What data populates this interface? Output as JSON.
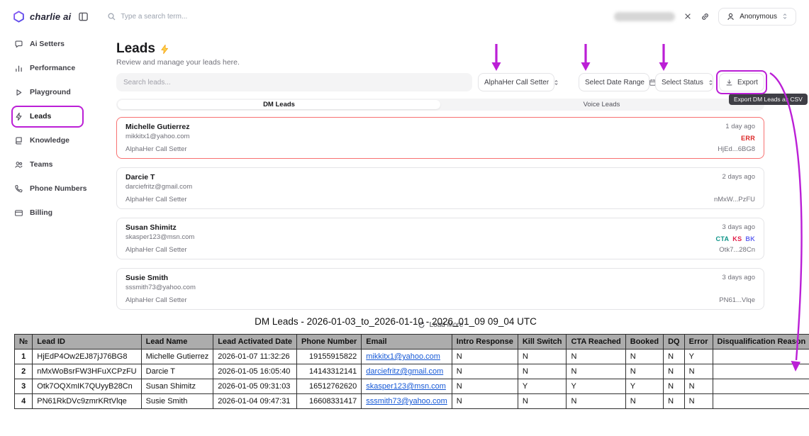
{
  "annotation_color": "#bb1fd6",
  "topbar": {
    "logo_text": "charlie ai",
    "search_placeholder": "Type a search term...",
    "user_label": "Anonymous"
  },
  "sidebar": {
    "items": [
      {
        "label": "Ai Setters",
        "icon": "chat-bubble-icon"
      },
      {
        "label": "Performance",
        "icon": "bar-chart-icon"
      },
      {
        "label": "Playground",
        "icon": "play-icon"
      },
      {
        "label": "Leads",
        "icon": "bolt-icon",
        "active": true
      },
      {
        "label": "Knowledge",
        "icon": "book-icon"
      },
      {
        "label": "Teams",
        "icon": "people-icon"
      },
      {
        "label": "Phone Numbers",
        "icon": "phone-icon"
      },
      {
        "label": "Billing",
        "icon": "credit-card-icon"
      }
    ]
  },
  "main": {
    "title": "Leads",
    "subtitle": "Review and manage your leads here.",
    "search_placeholder": "Search leads...",
    "filters": {
      "setter": "AlphaHer Call Setter",
      "date_range": "Select Date Range",
      "status": "Select Status"
    },
    "export_label": "Export",
    "export_tooltip": "Export DM Leads as CSV",
    "tabs": [
      {
        "label": "DM Leads",
        "active": true
      },
      {
        "label": "Voice Leads",
        "active": false
      }
    ],
    "load_more": "Load More",
    "leads": [
      {
        "name": "Michelle Gutierrez",
        "email": "mikkitx1@yahoo.com",
        "setter": "AlphaHer Call Setter",
        "time": "1 day ago",
        "badges": [
          {
            "text": "ERR",
            "color": "#dc2626"
          }
        ],
        "id": "HjEd...6BG8",
        "error": true
      },
      {
        "name": "Darcie T",
        "email": "darciefritz@gmail.com",
        "setter": "AlphaHer Call Setter",
        "time": "2 days ago",
        "badges": [],
        "id": "nMxW...PzFU",
        "error": false
      },
      {
        "name": "Susan Shimitz",
        "email": "skasper123@msn.com",
        "setter": "AlphaHer Call Setter",
        "time": "3 days ago",
        "badges": [
          {
            "text": "CTA",
            "color": "#0d9488"
          },
          {
            "text": "KS",
            "color": "#e11d48"
          },
          {
            "text": "BK",
            "color": "#6366f1"
          }
        ],
        "id": "Otk7...28Cn",
        "error": false
      },
      {
        "name": "Susie Smith",
        "email": "sssmith73@yahoo.com",
        "setter": "AlphaHer Call Setter",
        "time": "3 days ago",
        "badges": [],
        "id": "PN61...Vlqe",
        "error": false
      }
    ]
  },
  "table": {
    "title": "DM Leads - 2026-01-03_to_2026-01-10 - 2026_01_09 09_04 UTC",
    "columns": [
      "№",
      "Lead ID",
      "Lead Name",
      "Lead Activated Date",
      "Phone Number",
      "Email",
      "Intro Response",
      "Kill Switch",
      "CTA Reached",
      "Booked",
      "DQ",
      "Error",
      "Disqualification Reason"
    ],
    "email_col_index": 5,
    "rows": [
      [
        "1",
        "HjEdP4Ow2EJ87jJ76BG8",
        "Michelle Gutierrez",
        "2026-01-07 11:32:26",
        "19155915822",
        "mikkitx1@yahoo.com",
        "N",
        "N",
        "N",
        "N",
        "N",
        "Y",
        ""
      ],
      [
        "2",
        "nMxWoBsrFW3HFuXCPzFU",
        "Darcie T",
        "2026-01-05 16:05:40",
        "14143312141",
        "darciefritz@gmail.com",
        "N",
        "N",
        "N",
        "N",
        "N",
        "N",
        ""
      ],
      [
        "3",
        "Otk7OQXmIK7QUyyB28Cn",
        "Susan Shimitz",
        "2026-01-05 09:31:03",
        "16512762620",
        "skasper123@msn.com",
        "N",
        "Y",
        "Y",
        "Y",
        "N",
        "N",
        ""
      ],
      [
        "4",
        "PN61RkDVc9zmrKRtVlqe",
        "Susie Smith",
        "2026-01-04 09:47:31",
        "16608331417",
        "sssmith73@yahoo.com",
        "N",
        "N",
        "N",
        "N",
        "N",
        "N",
        ""
      ]
    ]
  }
}
